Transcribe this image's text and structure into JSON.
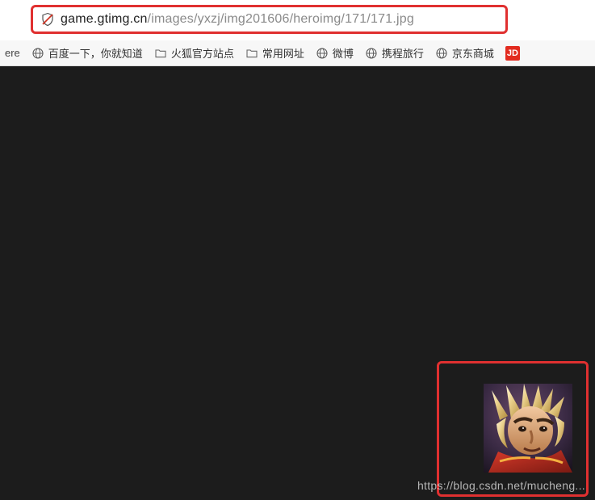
{
  "addressBar": {
    "url_host": "game.gtimg.cn",
    "url_path": "/images/yxzj/img201606/heroimg/171/171.jpg"
  },
  "bookmarks": {
    "truncated_left": "ere",
    "items": [
      {
        "icon": "globe",
        "label": "百度一下，你就知道"
      },
      {
        "icon": "folder",
        "label": "火狐官方站点"
      },
      {
        "icon": "folder",
        "label": "常用网址"
      },
      {
        "icon": "globe",
        "label": "微博"
      },
      {
        "icon": "globe",
        "label": "携程旅行"
      },
      {
        "icon": "globe",
        "label": "京东商城"
      },
      {
        "icon": "jd",
        "label": ""
      }
    ],
    "jd_badge_text": "JD"
  },
  "watermark": "https://blog.csdn.net/mucheng..."
}
